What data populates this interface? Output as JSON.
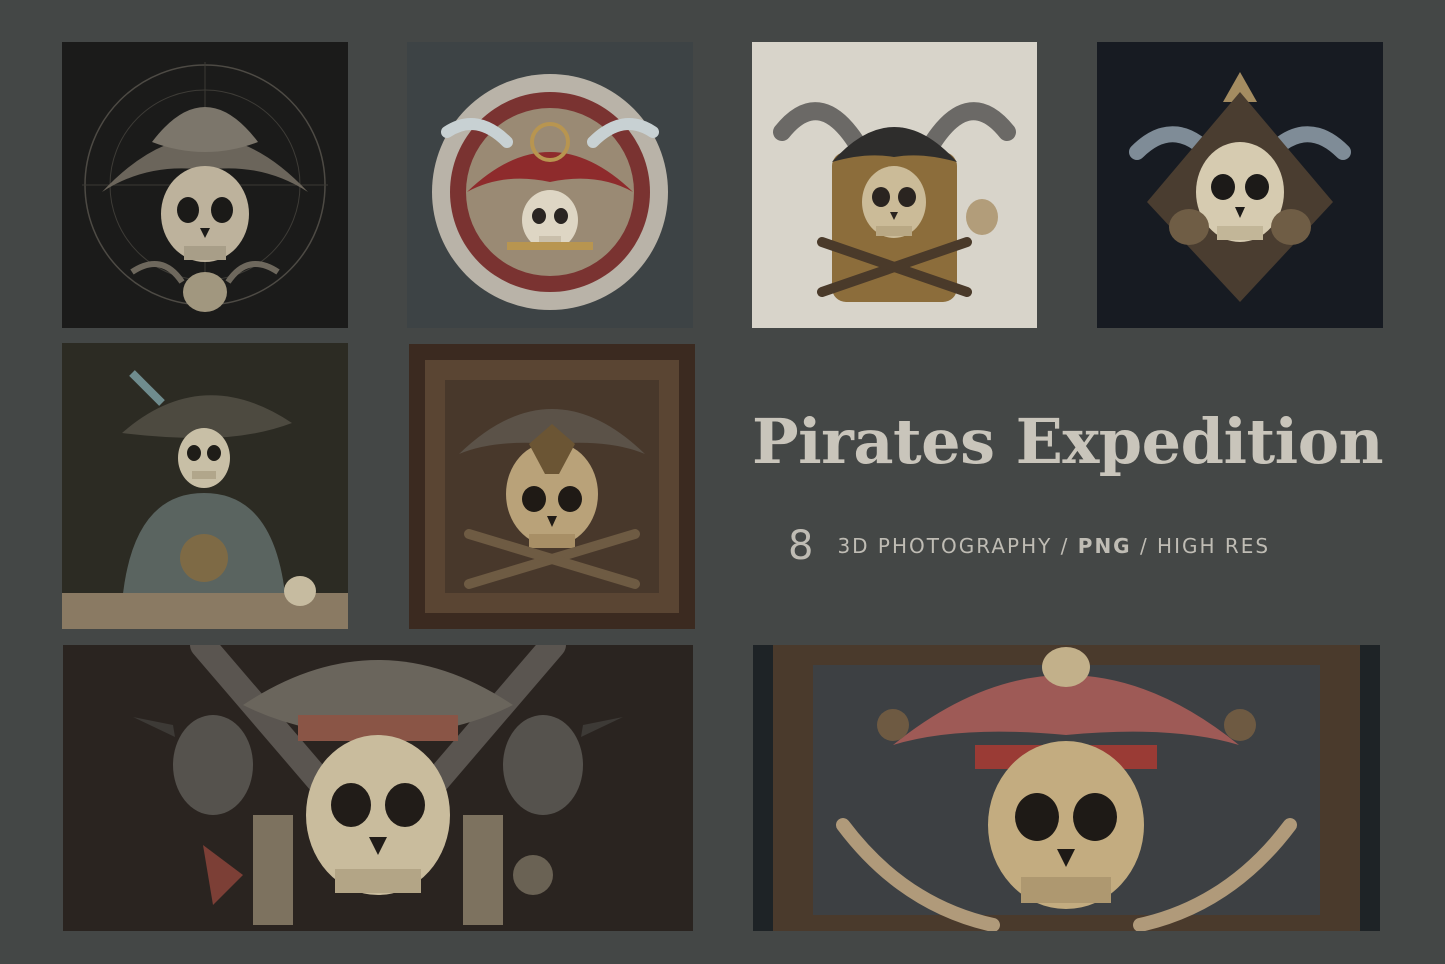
{
  "title": "Pirates Expedition",
  "count": "8",
  "meta": {
    "part1": "3D PHOTOGRAPHY",
    "sep1": " / ",
    "part2": "PNG",
    "sep2": " / ",
    "part3": "HIGH RES"
  },
  "colors": {
    "background": "#444746",
    "title": "#c9c5bb",
    "subtitle": "#bfbcb4",
    "bone": "#cfc2a4",
    "hat_red": "#8c2f2c"
  },
  "images": [
    {
      "id": "skull-tricorn-compass-art"
    },
    {
      "id": "skull-red-hat-wheel-emblem"
    },
    {
      "id": "skull-black-hat-eagles-plaque"
    },
    {
      "id": "skull-feathers-dark-emblem"
    },
    {
      "id": "skeleton-captain-portrait"
    },
    {
      "id": "skull-ship-carved-frame"
    },
    {
      "id": "skull-ravens-crossed-guns"
    },
    {
      "id": "skull-red-hat-carved-swords"
    }
  ]
}
